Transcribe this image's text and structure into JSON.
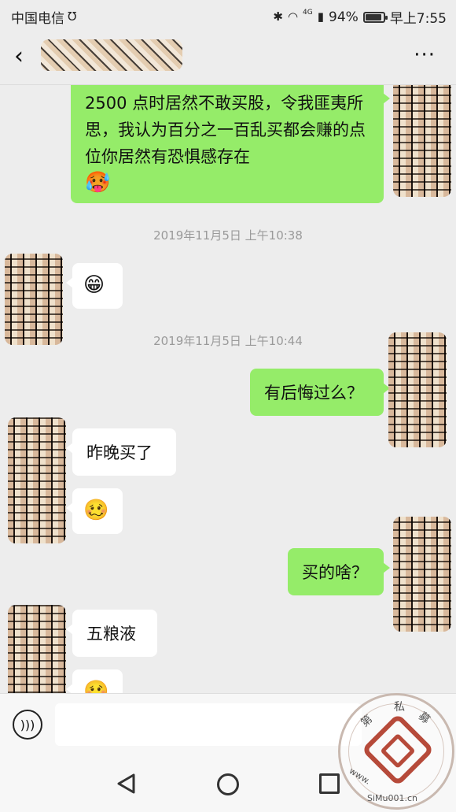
{
  "status_bar": {
    "carrier": "中国电信",
    "carrier_icon": "u-shield-icon",
    "network_type": "4G",
    "battery": "94%",
    "battery_level": 0.94,
    "time": "早上7:55"
  },
  "title_bar": {
    "contact_name_blurred": true,
    "back_icon": "chevron-left-icon",
    "more_icon": "more-dots-icon"
  },
  "messages": [
    {
      "side": "out",
      "text": "2500 点时居然不敢买股，令我匪夷所思，我认为百分之一百乱买都会赚的点位你居然有恐惧感存在",
      "emoji": "🥵"
    },
    {
      "type": "timestamp",
      "text": "2019年11月5日 上午10:38"
    },
    {
      "side": "in",
      "emoji": "😁"
    },
    {
      "type": "timestamp",
      "text": "2019年11月5日 上午10:44"
    },
    {
      "side": "out",
      "text": "有后悔过么？"
    },
    {
      "side": "in",
      "text": "昨晚买了"
    },
    {
      "side": "in",
      "emoji": "🥴"
    },
    {
      "side": "out",
      "text": "买的啥？"
    },
    {
      "side": "in",
      "text": "五粮液"
    },
    {
      "side": "in",
      "emoji": "🥴"
    }
  ],
  "input_bar": {
    "voice_icon": "voice-icon",
    "placeholder": ""
  },
  "watermark": {
    "chars": [
      "第",
      "私",
      "募"
    ],
    "url_a": "www.",
    "url_b": "SiMu001.cn"
  },
  "colors": {
    "outgoing_bubble": "#95ec69",
    "incoming_bubble": "#ffffff",
    "background": "#ededed"
  }
}
